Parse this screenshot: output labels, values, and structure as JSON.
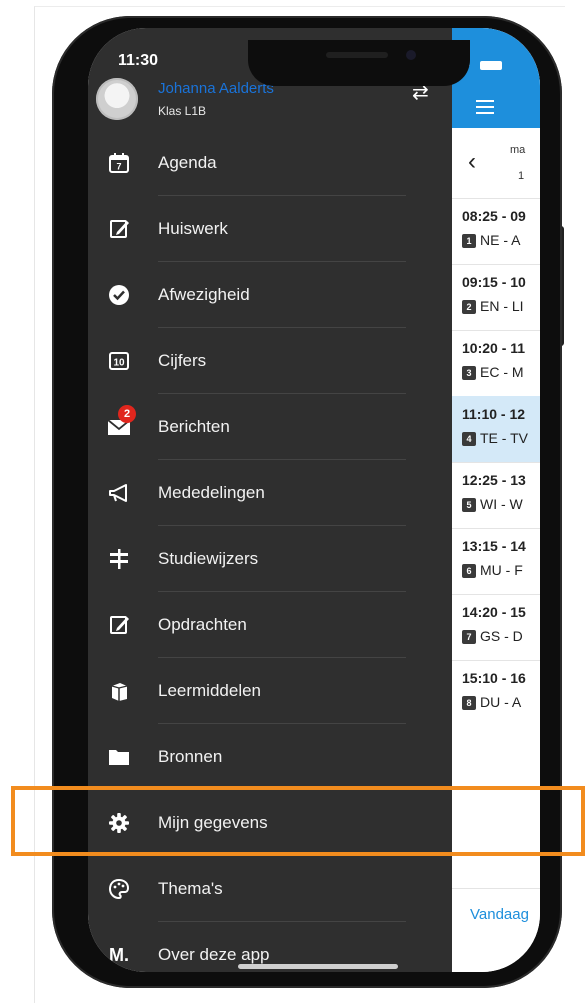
{
  "status": {
    "time": "11:30"
  },
  "user": {
    "name": "Johanna Aalderts",
    "class": "Klas L1B"
  },
  "menu": {
    "items": [
      {
        "label": "Agenda",
        "icon": "calendar-icon"
      },
      {
        "label": "Huiswerk",
        "icon": "edit-icon"
      },
      {
        "label": "Afwezigheid",
        "icon": "check-circle-icon"
      },
      {
        "label": "Cijfers",
        "icon": "grades-icon"
      },
      {
        "label": "Berichten",
        "icon": "mail-icon",
        "badge": "2"
      },
      {
        "label": "Mededelingen",
        "icon": "megaphone-icon"
      },
      {
        "label": "Studiewijzers",
        "icon": "signpost-icon"
      },
      {
        "label": "Opdrachten",
        "icon": "edit-icon"
      },
      {
        "label": "Leermiddelen",
        "icon": "books-icon"
      },
      {
        "label": "Bronnen",
        "icon": "folder-icon"
      },
      {
        "label": "Mijn gegevens",
        "icon": "gear-icon"
      },
      {
        "label": "Thema's",
        "icon": "palette-icon"
      },
      {
        "label": "Over deze app",
        "icon": "magister-logo-icon"
      }
    ],
    "grades_icon_text": "10",
    "calendar_icon_text": "7",
    "logo_text": "M."
  },
  "calendar": {
    "day": "ma",
    "date": "1",
    "today_label": "Vandaag",
    "slots": [
      {
        "time": "08:25 - 09",
        "num": "1",
        "subject": "NE - A"
      },
      {
        "time": "09:15 - 10",
        "num": "2",
        "subject": "EN - LI"
      },
      {
        "time": "10:20 - 11",
        "num": "3",
        "subject": "EC - M"
      },
      {
        "time": "11:10 - 12",
        "num": "4",
        "subject": "TE - TV"
      },
      {
        "time": "12:25 - 13",
        "num": "5",
        "subject": "WI - W"
      },
      {
        "time": "13:15 - 14",
        "num": "6",
        "subject": "MU - F"
      },
      {
        "time": "14:20 - 15",
        "num": "7",
        "subject": "GS - D"
      },
      {
        "time": "15:10 - 16",
        "num": "8",
        "subject": "DU - A"
      }
    ]
  },
  "colors": {
    "accent": "#1e8fdc",
    "drawer": "#2f2f2f",
    "highlight": "#f28c1e",
    "badge": "#e0261d"
  }
}
